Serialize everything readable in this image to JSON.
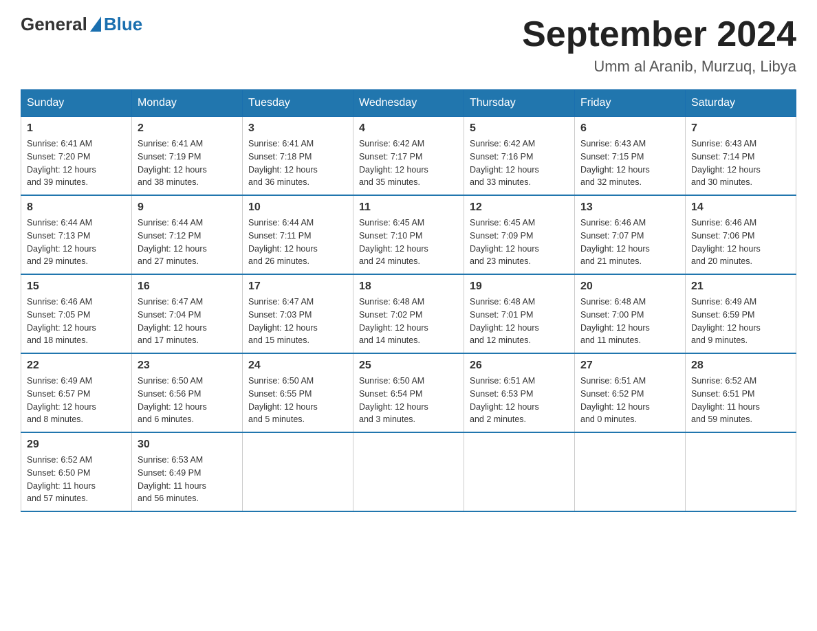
{
  "logo": {
    "general": "General",
    "blue": "Blue"
  },
  "title": "September 2024",
  "subtitle": "Umm al Aranib, Murzuq, Libya",
  "days_of_week": [
    "Sunday",
    "Monday",
    "Tuesday",
    "Wednesday",
    "Thursday",
    "Friday",
    "Saturday"
  ],
  "weeks": [
    [
      {
        "day": "1",
        "sunrise": "6:41 AM",
        "sunset": "7:20 PM",
        "daylight": "12 hours and 39 minutes."
      },
      {
        "day": "2",
        "sunrise": "6:41 AM",
        "sunset": "7:19 PM",
        "daylight": "12 hours and 38 minutes."
      },
      {
        "day": "3",
        "sunrise": "6:41 AM",
        "sunset": "7:18 PM",
        "daylight": "12 hours and 36 minutes."
      },
      {
        "day": "4",
        "sunrise": "6:42 AM",
        "sunset": "7:17 PM",
        "daylight": "12 hours and 35 minutes."
      },
      {
        "day": "5",
        "sunrise": "6:42 AM",
        "sunset": "7:16 PM",
        "daylight": "12 hours and 33 minutes."
      },
      {
        "day": "6",
        "sunrise": "6:43 AM",
        "sunset": "7:15 PM",
        "daylight": "12 hours and 32 minutes."
      },
      {
        "day": "7",
        "sunrise": "6:43 AM",
        "sunset": "7:14 PM",
        "daylight": "12 hours and 30 minutes."
      }
    ],
    [
      {
        "day": "8",
        "sunrise": "6:44 AM",
        "sunset": "7:13 PM",
        "daylight": "12 hours and 29 minutes."
      },
      {
        "day": "9",
        "sunrise": "6:44 AM",
        "sunset": "7:12 PM",
        "daylight": "12 hours and 27 minutes."
      },
      {
        "day": "10",
        "sunrise": "6:44 AM",
        "sunset": "7:11 PM",
        "daylight": "12 hours and 26 minutes."
      },
      {
        "day": "11",
        "sunrise": "6:45 AM",
        "sunset": "7:10 PM",
        "daylight": "12 hours and 24 minutes."
      },
      {
        "day": "12",
        "sunrise": "6:45 AM",
        "sunset": "7:09 PM",
        "daylight": "12 hours and 23 minutes."
      },
      {
        "day": "13",
        "sunrise": "6:46 AM",
        "sunset": "7:07 PM",
        "daylight": "12 hours and 21 minutes."
      },
      {
        "day": "14",
        "sunrise": "6:46 AM",
        "sunset": "7:06 PM",
        "daylight": "12 hours and 20 minutes."
      }
    ],
    [
      {
        "day": "15",
        "sunrise": "6:46 AM",
        "sunset": "7:05 PM",
        "daylight": "12 hours and 18 minutes."
      },
      {
        "day": "16",
        "sunrise": "6:47 AM",
        "sunset": "7:04 PM",
        "daylight": "12 hours and 17 minutes."
      },
      {
        "day": "17",
        "sunrise": "6:47 AM",
        "sunset": "7:03 PM",
        "daylight": "12 hours and 15 minutes."
      },
      {
        "day": "18",
        "sunrise": "6:48 AM",
        "sunset": "7:02 PM",
        "daylight": "12 hours and 14 minutes."
      },
      {
        "day": "19",
        "sunrise": "6:48 AM",
        "sunset": "7:01 PM",
        "daylight": "12 hours and 12 minutes."
      },
      {
        "day": "20",
        "sunrise": "6:48 AM",
        "sunset": "7:00 PM",
        "daylight": "12 hours and 11 minutes."
      },
      {
        "day": "21",
        "sunrise": "6:49 AM",
        "sunset": "6:59 PM",
        "daylight": "12 hours and 9 minutes."
      }
    ],
    [
      {
        "day": "22",
        "sunrise": "6:49 AM",
        "sunset": "6:57 PM",
        "daylight": "12 hours and 8 minutes."
      },
      {
        "day": "23",
        "sunrise": "6:50 AM",
        "sunset": "6:56 PM",
        "daylight": "12 hours and 6 minutes."
      },
      {
        "day": "24",
        "sunrise": "6:50 AM",
        "sunset": "6:55 PM",
        "daylight": "12 hours and 5 minutes."
      },
      {
        "day": "25",
        "sunrise": "6:50 AM",
        "sunset": "6:54 PM",
        "daylight": "12 hours and 3 minutes."
      },
      {
        "day": "26",
        "sunrise": "6:51 AM",
        "sunset": "6:53 PM",
        "daylight": "12 hours and 2 minutes."
      },
      {
        "day": "27",
        "sunrise": "6:51 AM",
        "sunset": "6:52 PM",
        "daylight": "12 hours and 0 minutes."
      },
      {
        "day": "28",
        "sunrise": "6:52 AM",
        "sunset": "6:51 PM",
        "daylight": "11 hours and 59 minutes."
      }
    ],
    [
      {
        "day": "29",
        "sunrise": "6:52 AM",
        "sunset": "6:50 PM",
        "daylight": "11 hours and 57 minutes."
      },
      {
        "day": "30",
        "sunrise": "6:53 AM",
        "sunset": "6:49 PM",
        "daylight": "11 hours and 56 minutes."
      },
      null,
      null,
      null,
      null,
      null
    ]
  ],
  "labels": {
    "sunrise": "Sunrise: ",
    "sunset": "Sunset: ",
    "daylight": "Daylight: "
  }
}
